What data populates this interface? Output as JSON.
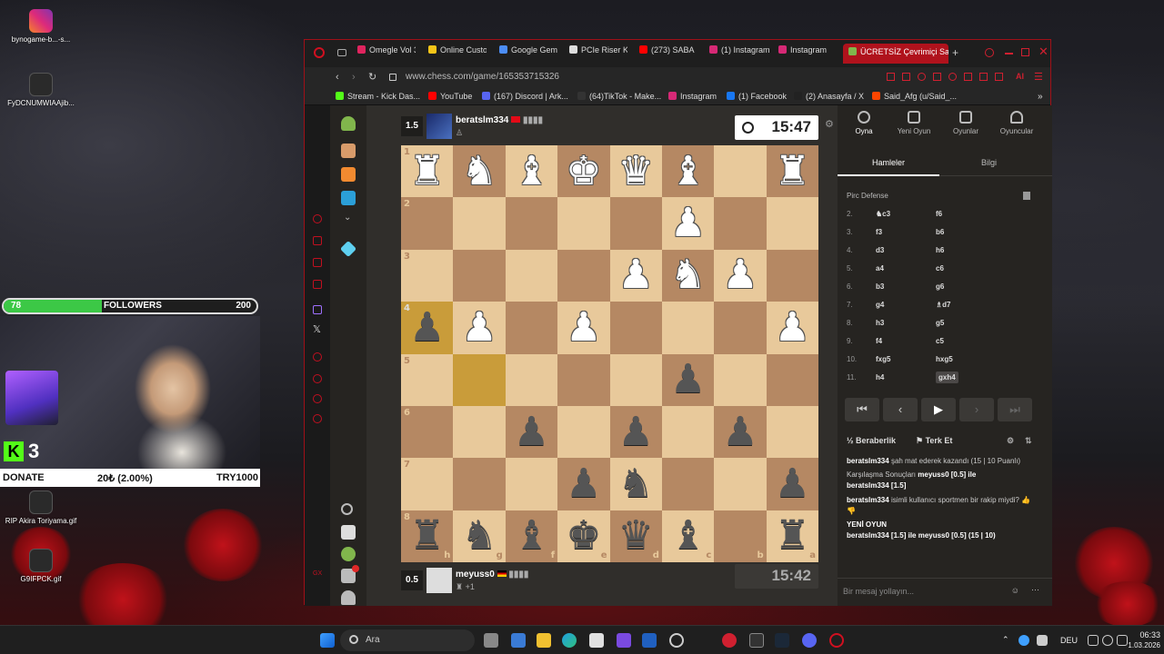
{
  "desktop": {
    "icons": [
      {
        "label": "bynogame-b...-s..."
      },
      {
        "label": "FyDCNUMWIAAjib..."
      },
      {
        "label": "RIP Akira Toriyama.gif"
      },
      {
        "label": "G9IFPCK.gif"
      }
    ]
  },
  "overlay": {
    "followers_current": "78",
    "followers_label": "FOLLOWERS",
    "followers_goal": "200",
    "followers_progress": 0.39,
    "kick_count": "3",
    "donate_label": "DONATE",
    "donate_progress": "20₺ (2.00%)",
    "donate_goal": "TRY1000"
  },
  "browser": {
    "tabs": [
      {
        "label": "Omegle Vol 3",
        "color": "#e0245e"
      },
      {
        "label": "Online Custo",
        "color": "#f5c518"
      },
      {
        "label": "Google Gem",
        "color": "#4c8df6"
      },
      {
        "label": "PCIe Riser K",
        "color": "#dddddd"
      },
      {
        "label": "(273) SABA",
        "color": "#ff0000"
      },
      {
        "label": "(1) Instagram",
        "color": "#d62976"
      },
      {
        "label": "Instagram",
        "color": "#d62976"
      },
      {
        "label": "ÜCRETSİZ Çevrimiçi Sa",
        "color": "#81b64c"
      }
    ],
    "url": "www.chess.com/game/165353715326",
    "bookmarks": [
      {
        "label": "Stream - Kick Das...",
        "color": "#53fc18"
      },
      {
        "label": "YouTube",
        "color": "#ff0000"
      },
      {
        "label": "(167) Discord | Ark...",
        "color": "#5865f2"
      },
      {
        "label": "(64)TikTok - Make...",
        "color": "#333333"
      },
      {
        "label": "Instagram",
        "color": "#d62976"
      },
      {
        "label": "(1) Facebook",
        "color": "#1877f2"
      },
      {
        "label": "(2) Anasayfa / X",
        "color": "#222222"
      },
      {
        "label": "Said_Afg (u/Said_...",
        "color": "#ff4500"
      }
    ]
  },
  "game": {
    "top_player": {
      "rating": "1.5",
      "name": "beratslm334",
      "clock": "15:47"
    },
    "bottom_player": {
      "rating": "0.5",
      "name": "meyuss0",
      "sub": "+1",
      "clock": "15:42"
    },
    "board": [
      [
        "wR",
        "wN",
        "wB",
        "wK",
        "wQ",
        "wB",
        "",
        "wR"
      ],
      [
        "",
        "",
        "",
        "",
        "",
        "wP",
        "",
        ""
      ],
      [
        "",
        "",
        "",
        "",
        "wP",
        "wN",
        "wP",
        ""
      ],
      [
        "bP",
        "wP",
        "",
        "wP",
        "",
        "",
        "",
        "wP"
      ],
      [
        "",
        "",
        "",
        "",
        "",
        "bP",
        "",
        ""
      ],
      [
        "",
        "",
        "bP",
        "",
        "bP",
        "",
        "bP",
        ""
      ],
      [
        "",
        "",
        "",
        "bP",
        "bN",
        "",
        "",
        "bP"
      ],
      [
        "bR",
        "bN",
        "bB",
        "bK",
        "bQ",
        "bB",
        "",
        "bR"
      ]
    ],
    "rank_labels": [
      "1",
      "2",
      "3",
      "4",
      "5",
      "6",
      "7",
      "8"
    ],
    "file_labels": [
      "h",
      "g",
      "f",
      "e",
      "d",
      "c",
      "b",
      "a"
    ],
    "highlight_squares": [
      [
        3,
        0
      ],
      [
        4,
        1
      ]
    ]
  },
  "panel": {
    "tabs": [
      {
        "label": "Oyna"
      },
      {
        "label": "Yeni Oyun"
      },
      {
        "label": "Oyunlar"
      },
      {
        "label": "Oyuncular"
      }
    ],
    "subtab_moves": "Hamleler",
    "subtab_info": "Bilgi",
    "opening": "Pirc Defense",
    "moves": [
      {
        "n": "2.",
        "w": "♞c3",
        "b": "f6"
      },
      {
        "n": "3.",
        "w": "f3",
        "b": "b6"
      },
      {
        "n": "4.",
        "w": "d3",
        "b": "h6"
      },
      {
        "n": "5.",
        "w": "a4",
        "b": "c6"
      },
      {
        "n": "6.",
        "w": "b3",
        "b": "g6"
      },
      {
        "n": "7.",
        "w": "g4",
        "b": "♗d7"
      },
      {
        "n": "8.",
        "w": "h3",
        "b": "g5"
      },
      {
        "n": "9.",
        "w": "f4",
        "b": "c5"
      },
      {
        "n": "10.",
        "w": "fxg5",
        "b": "hxg5"
      },
      {
        "n": "11.",
        "w": "h4",
        "b": "gxh4"
      }
    ],
    "draw_label": "Beraberlik",
    "resign_label": "Terk Et",
    "chat": {
      "line1_user": "beratslm334",
      "line1_text": "şah mat ederek kazandı (15 | 10 Puanlı)",
      "line2_text": "Karşılaşma Sonuçları",
      "line2_rest": "meyuss0 [0.5] ile",
      "line2_user": "beratslm334 [1.5]",
      "line3_user": "beratslm334",
      "line3_text": "isimli kullanıcı sportmen bir rakip miydi?",
      "new_game": "YENİ OYUN",
      "line4": "beratslm334 [1.5] ile meyuss0 [0.5] (15 | 10)"
    },
    "message_placeholder": "Bir mesaj yollayın..."
  },
  "taskbar": {
    "search_label": "Ara",
    "language": "DEU",
    "time": "06:33",
    "date": "1.03.2026"
  }
}
